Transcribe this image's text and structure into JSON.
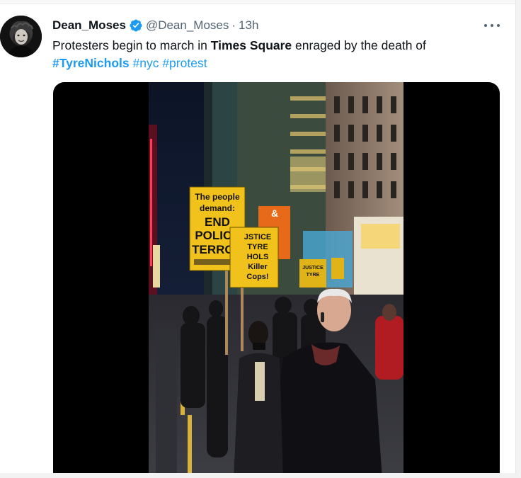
{
  "tweet": {
    "display_name": "Dean_Moses",
    "handle": "@Dean_Moses",
    "separator": "·",
    "time": "13h",
    "text_part1": "Protesters begin to march in ",
    "text_bold": "Times Square",
    "text_part2": " enraged by the death of",
    "hashtags": [
      "#TyreNichols",
      "#nyc",
      "#protest"
    ],
    "verified_color": "#1d9bf0"
  },
  "media": {
    "signs": {
      "main_line1": "The people",
      "main_line2": "demand:",
      "main_line3": "END",
      "main_line4": "POLICE",
      "main_line5": "TERROR",
      "second_line1": "JSTICE",
      "second_line2": "TYRE",
      "second_line3": "HOLS",
      "second_line4": "Killer",
      "second_line5": "Cops!",
      "third_line1": "JUSTICE",
      "third_line2": "TYRE",
      "billboard": "&"
    }
  }
}
